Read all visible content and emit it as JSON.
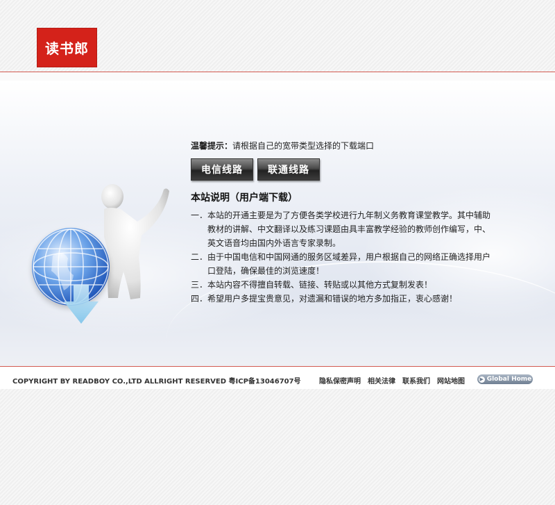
{
  "header": {
    "logo_text": "读书郎"
  },
  "main": {
    "tip_label": "温馨提示：",
    "tip_text": "请根据自己的宽带类型选择的下载端口",
    "buttons": [
      "电信线路",
      "联通线路"
    ],
    "section_title": "本站说明（用户端下载）",
    "notes": [
      "一．本站的开通主要是为了方便各类学校进行九年制义务教育课堂教学。其中辅助教材的讲解、中文翻译以及练习课题由具丰富教学经验的教师创作编写，中、英文语音均由国内外语言专家录制。",
      "二．由于中国电信和中国网通的服务区域差异，用户根据自己的网络正确选择用户口登陆，确保最佳的浏览速度！",
      "三．本站内容不得擅自转载、链接、转贴或以其他方式复制发表！",
      "四．希望用户多提宝贵意见，对遗漏和错误的地方多加指正，衷心感谢！"
    ]
  },
  "footer": {
    "copyright": "COPYRIGHT BY READBOY CO.,LTD ALLRIGHT RESERVED 粤ICP备13046707号",
    "links": [
      "隐私保密声明",
      "相关法律",
      "联系我们",
      "网站地图"
    ],
    "global_home": "Global Home"
  },
  "colors": {
    "brand_red": "#d4221a",
    "line_red": "#d25a50",
    "button_dark": "#333333"
  },
  "icons": [
    "globe-icon",
    "download-arrow-icon",
    "play-circle-icon"
  ]
}
